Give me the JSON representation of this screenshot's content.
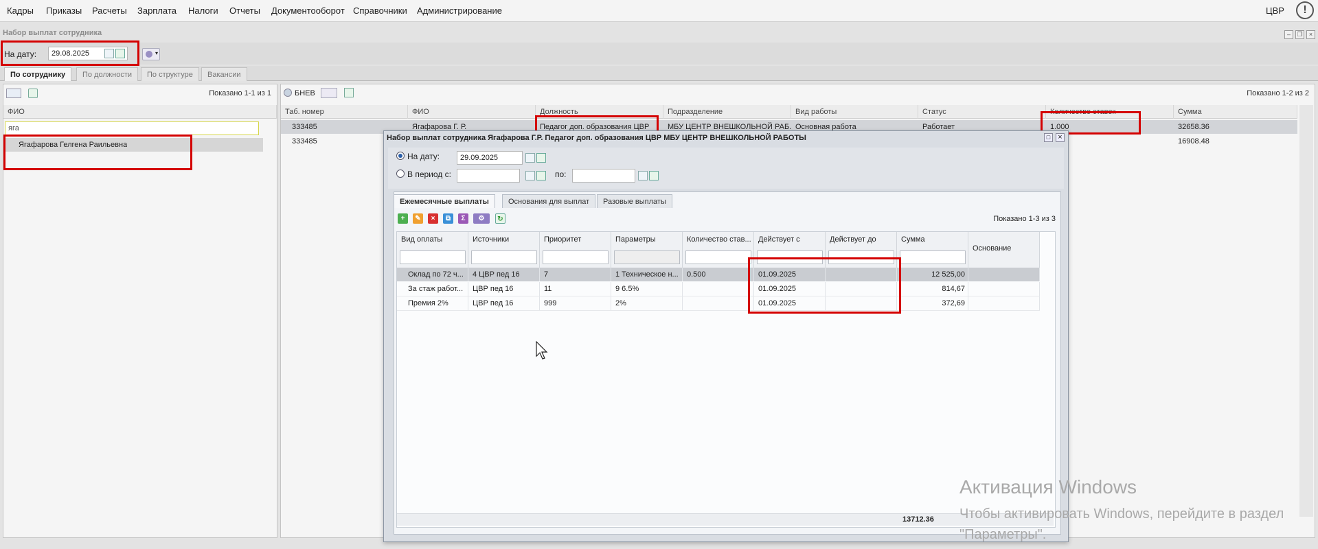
{
  "menu": [
    "Кадры",
    "Приказы",
    "Расчеты",
    "Зарплата",
    "Налоги",
    "Отчеты",
    "Документооборот",
    "Справочники",
    "Администрирование"
  ],
  "user": "ЦВР",
  "panel": {
    "title": "Набор выплат сотрудника",
    "date_label": "На дату:",
    "date_value": "29.08.2025",
    "tabs": [
      "По сотруднику",
      "По должности",
      "По структуре",
      "Вакансии"
    ]
  },
  "left": {
    "shown": "Показано 1-1 из 1",
    "col": "ФИО",
    "filter": "яга",
    "employee": "Ягафарова Гелгена Раильевна"
  },
  "right": {
    "bnev": "БНЕВ",
    "shown": "Показано 1-2 из 2",
    "cols": [
      "Таб. номер",
      "ФИО",
      "Должность",
      "Подразделение",
      "Вид работы",
      "Статус",
      "Количество ставок",
      "Сумма"
    ],
    "rows": [
      [
        "333485",
        "Ягафарова Г. Р.",
        "Педагог доп. образования ЦВР",
        "МБУ ЦЕНТР ВНЕШКОЛЬНОЙ РАБ...",
        "Основная работа",
        "Работает",
        "1.000",
        "32658.36"
      ],
      [
        "333485",
        "",
        "",
        "",
        "",
        "",
        "",
        "16908.48"
      ]
    ]
  },
  "dialog": {
    "title": "Набор выплат сотрудника Ягафарова Г.Р. Педагог доп. образования ЦВР МБУ ЦЕНТР ВНЕШКОЛЬНОЙ РАБОТЫ",
    "radio_date": "На дату:",
    "date_value": "29.09.2025",
    "radio_period": "В период с:",
    "period_to": "по:",
    "tabs": [
      "Ежемесячные выплаты",
      "Основания для выплат",
      "Разовые выплаты"
    ],
    "shown": "Показано 1-3 из 3",
    "cols": [
      "Вид оплаты",
      "Источники",
      "Приоритет",
      "Параметры",
      "Количество став...",
      "Действует с",
      "Действует до",
      "Сумма",
      "Основание"
    ],
    "rows": [
      [
        "Оклад по 72 ч...",
        "4 ЦВР пед 16",
        "7",
        "1 Техническое н...",
        "0.500",
        "01.09.2025",
        "",
        "12 525,00",
        ""
      ],
      [
        "За стаж работ...",
        "ЦВР пед 16",
        "11",
        "9 6.5%",
        "",
        "01.09.2025",
        "",
        "814,67",
        ""
      ],
      [
        "Премия 2%",
        "ЦВР пед 16",
        "999",
        "2%",
        "",
        "01.09.2025",
        "",
        "372,69",
        ""
      ]
    ],
    "total": "13712.36"
  },
  "watermark": {
    "line1": "Активация Windows",
    "line2": "Чтобы активировать Windows, перейдите в раздел \"Параметры\"."
  },
  "icons": [
    "alert-icon",
    "calendar-icon",
    "date-pick-icon",
    "settings-icon",
    "refresh-icon",
    "add-icon",
    "edit-icon",
    "delete-icon",
    "copy-icon",
    "sum-icon",
    "cursor-icon"
  ]
}
